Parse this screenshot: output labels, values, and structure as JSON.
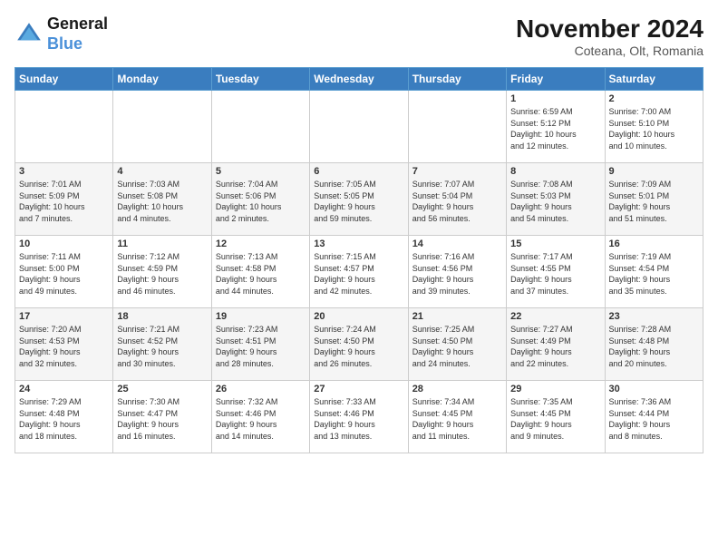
{
  "header": {
    "logo_general": "General",
    "logo_blue": "Blue",
    "month_year": "November 2024",
    "location": "Coteana, Olt, Romania"
  },
  "days_of_week": [
    "Sunday",
    "Monday",
    "Tuesday",
    "Wednesday",
    "Thursday",
    "Friday",
    "Saturday"
  ],
  "weeks": [
    {
      "days": [
        {
          "num": "",
          "info": ""
        },
        {
          "num": "",
          "info": ""
        },
        {
          "num": "",
          "info": ""
        },
        {
          "num": "",
          "info": ""
        },
        {
          "num": "",
          "info": ""
        },
        {
          "num": "1",
          "info": "Sunrise: 6:59 AM\nSunset: 5:12 PM\nDaylight: 10 hours\nand 12 minutes."
        },
        {
          "num": "2",
          "info": "Sunrise: 7:00 AM\nSunset: 5:10 PM\nDaylight: 10 hours\nand 10 minutes."
        }
      ]
    },
    {
      "days": [
        {
          "num": "3",
          "info": "Sunrise: 7:01 AM\nSunset: 5:09 PM\nDaylight: 10 hours\nand 7 minutes."
        },
        {
          "num": "4",
          "info": "Sunrise: 7:03 AM\nSunset: 5:08 PM\nDaylight: 10 hours\nand 4 minutes."
        },
        {
          "num": "5",
          "info": "Sunrise: 7:04 AM\nSunset: 5:06 PM\nDaylight: 10 hours\nand 2 minutes."
        },
        {
          "num": "6",
          "info": "Sunrise: 7:05 AM\nSunset: 5:05 PM\nDaylight: 9 hours\nand 59 minutes."
        },
        {
          "num": "7",
          "info": "Sunrise: 7:07 AM\nSunset: 5:04 PM\nDaylight: 9 hours\nand 56 minutes."
        },
        {
          "num": "8",
          "info": "Sunrise: 7:08 AM\nSunset: 5:03 PM\nDaylight: 9 hours\nand 54 minutes."
        },
        {
          "num": "9",
          "info": "Sunrise: 7:09 AM\nSunset: 5:01 PM\nDaylight: 9 hours\nand 51 minutes."
        }
      ]
    },
    {
      "days": [
        {
          "num": "10",
          "info": "Sunrise: 7:11 AM\nSunset: 5:00 PM\nDaylight: 9 hours\nand 49 minutes."
        },
        {
          "num": "11",
          "info": "Sunrise: 7:12 AM\nSunset: 4:59 PM\nDaylight: 9 hours\nand 46 minutes."
        },
        {
          "num": "12",
          "info": "Sunrise: 7:13 AM\nSunset: 4:58 PM\nDaylight: 9 hours\nand 44 minutes."
        },
        {
          "num": "13",
          "info": "Sunrise: 7:15 AM\nSunset: 4:57 PM\nDaylight: 9 hours\nand 42 minutes."
        },
        {
          "num": "14",
          "info": "Sunrise: 7:16 AM\nSunset: 4:56 PM\nDaylight: 9 hours\nand 39 minutes."
        },
        {
          "num": "15",
          "info": "Sunrise: 7:17 AM\nSunset: 4:55 PM\nDaylight: 9 hours\nand 37 minutes."
        },
        {
          "num": "16",
          "info": "Sunrise: 7:19 AM\nSunset: 4:54 PM\nDaylight: 9 hours\nand 35 minutes."
        }
      ]
    },
    {
      "days": [
        {
          "num": "17",
          "info": "Sunrise: 7:20 AM\nSunset: 4:53 PM\nDaylight: 9 hours\nand 32 minutes."
        },
        {
          "num": "18",
          "info": "Sunrise: 7:21 AM\nSunset: 4:52 PM\nDaylight: 9 hours\nand 30 minutes."
        },
        {
          "num": "19",
          "info": "Sunrise: 7:23 AM\nSunset: 4:51 PM\nDaylight: 9 hours\nand 28 minutes."
        },
        {
          "num": "20",
          "info": "Sunrise: 7:24 AM\nSunset: 4:50 PM\nDaylight: 9 hours\nand 26 minutes."
        },
        {
          "num": "21",
          "info": "Sunrise: 7:25 AM\nSunset: 4:50 PM\nDaylight: 9 hours\nand 24 minutes."
        },
        {
          "num": "22",
          "info": "Sunrise: 7:27 AM\nSunset: 4:49 PM\nDaylight: 9 hours\nand 22 minutes."
        },
        {
          "num": "23",
          "info": "Sunrise: 7:28 AM\nSunset: 4:48 PM\nDaylight: 9 hours\nand 20 minutes."
        }
      ]
    },
    {
      "days": [
        {
          "num": "24",
          "info": "Sunrise: 7:29 AM\nSunset: 4:48 PM\nDaylight: 9 hours\nand 18 minutes."
        },
        {
          "num": "25",
          "info": "Sunrise: 7:30 AM\nSunset: 4:47 PM\nDaylight: 9 hours\nand 16 minutes."
        },
        {
          "num": "26",
          "info": "Sunrise: 7:32 AM\nSunset: 4:46 PM\nDaylight: 9 hours\nand 14 minutes."
        },
        {
          "num": "27",
          "info": "Sunrise: 7:33 AM\nSunset: 4:46 PM\nDaylight: 9 hours\nand 13 minutes."
        },
        {
          "num": "28",
          "info": "Sunrise: 7:34 AM\nSunset: 4:45 PM\nDaylight: 9 hours\nand 11 minutes."
        },
        {
          "num": "29",
          "info": "Sunrise: 7:35 AM\nSunset: 4:45 PM\nDaylight: 9 hours\nand 9 minutes."
        },
        {
          "num": "30",
          "info": "Sunrise: 7:36 AM\nSunset: 4:44 PM\nDaylight: 9 hours\nand 8 minutes."
        }
      ]
    }
  ]
}
